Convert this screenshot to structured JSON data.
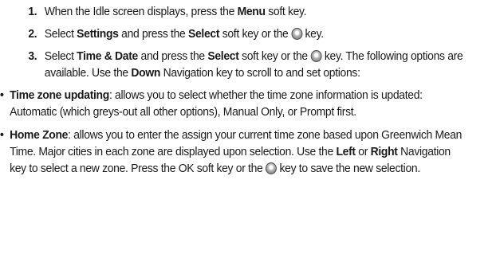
{
  "steps": [
    {
      "num": "1.",
      "t1": "When the Idle screen displays, press the ",
      "b1": "Menu",
      "t2": " soft key."
    },
    {
      "num": "2.",
      "t1": "Select ",
      "b1": "Settings",
      "t2": " and press the ",
      "b2": "Select",
      "t3": " soft key or the ",
      "t4": " key."
    },
    {
      "num": "3.",
      "t1": "Select ",
      "b1": "Time & Date",
      "t2": " and press the ",
      "b2": "Select",
      "t3": " soft key or the ",
      "t4": " key. The following options are available. Use the ",
      "b3": "Down",
      "t5": " Navigation key to scroll to and set options:"
    }
  ],
  "bullets": [
    {
      "dot": "•",
      "term": "Time zone updating",
      "t1": ": allows you to select whether the time zone information is updated: Automatic (which greys-out all other options), Manual Only, or Prompt first."
    },
    {
      "dot": "•",
      "term": "Home Zone",
      "t1": ": allows you to enter the assign your current time zone based upon Greenwich Mean Time. Major cities in each zone are displayed upon selection. Use the ",
      "b1": "Left",
      "t2": " or ",
      "b2": "Right",
      "t3": " Navigation key to select a new zone. Press the OK soft key or the ",
      "t4": " key to save the new selection."
    }
  ],
  "icons": {
    "select_key": "select-key-icon"
  }
}
